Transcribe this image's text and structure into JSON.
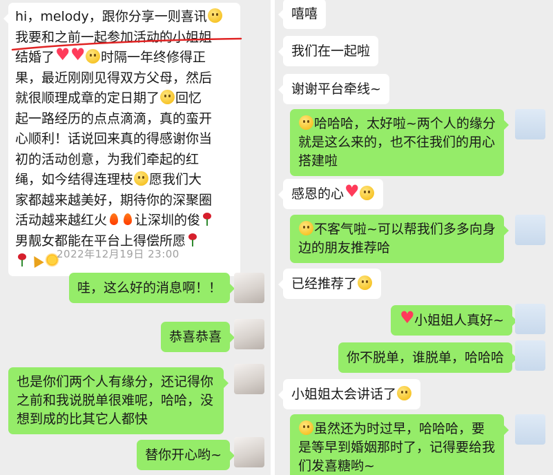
{
  "left": {
    "first_message": {
      "line1": "hi，melody，跟你分享一则喜讯",
      "line2": "我要和之前一起参加活动的小姐姐",
      "line3a": "结婚了",
      "line3b": "时隔一年终修得正",
      "line4": "果，最近刚刚见得双方父母，然后",
      "line5a": "就很顺理成章的定日期了",
      "line5b": "回忆",
      "line6": "起一路经历的点点滴滴，真的蛮开",
      "line7": "心顺利！话说回来真的得感谢你当",
      "line8": "初的活动创意，为我们牵起的红",
      "line9a": "绳，如今结得连理枝",
      "line9b": "愿我们大",
      "line10": "家都越来越美好，期待你的深聚圈",
      "line11a": "活动越来越红火",
      "line11b": "让深圳的俊",
      "line12": "男靓女都能在平台上得偿所愿"
    },
    "timestamp": "2022年12月19日 23:00",
    "replies": [
      "哇，这么好的消息啊！！",
      "恭喜恭喜",
      "也是你们两个人有缘分，还记得你之前和我说脱单很难呢，哈哈，没想到成的比其它人都快",
      "替你开心哟~"
    ]
  },
  "right": {
    "messages": [
      {
        "side": "in",
        "text": "嘻嘻"
      },
      {
        "side": "in",
        "text": "我们在一起啦"
      },
      {
        "side": "in",
        "text": "谢谢平台牵线~"
      },
      {
        "side": "out",
        "text": "哈哈哈，太好啦~两个人的缘分就是这么来的，也不往我们的用心搭建啦"
      },
      {
        "side": "in",
        "text": "感恩的心"
      },
      {
        "side": "out",
        "text": "不客气啦~可以帮我们多多向身边的朋友推荐哈"
      },
      {
        "side": "in",
        "text": "已经推荐了"
      },
      {
        "side": "out",
        "text": "小姐姐人真好~"
      },
      {
        "side": "out",
        "text": "你不脱单，谁脱单，哈哈哈"
      },
      {
        "side": "in",
        "text": "小姐姐太会讲话了"
      },
      {
        "side": "out",
        "text": "虽然还为时过早，哈哈哈，要是等早到婚姻那时了，记得要给我们发喜糖哟~"
      }
    ]
  },
  "colors": {
    "chat_background": "#ededed",
    "incoming_bubble": "#ffffff",
    "outgoing_bubble": "#95ec69",
    "annotation_line": "#e02424"
  },
  "icons": [
    "grin-emoji",
    "heart-emoji",
    "smile-emoji",
    "fire-emoji",
    "rose-emoji",
    "party-emoji",
    "sun-emoji",
    "wink-emoji",
    "avatar-woman",
    "avatar-girl"
  ]
}
